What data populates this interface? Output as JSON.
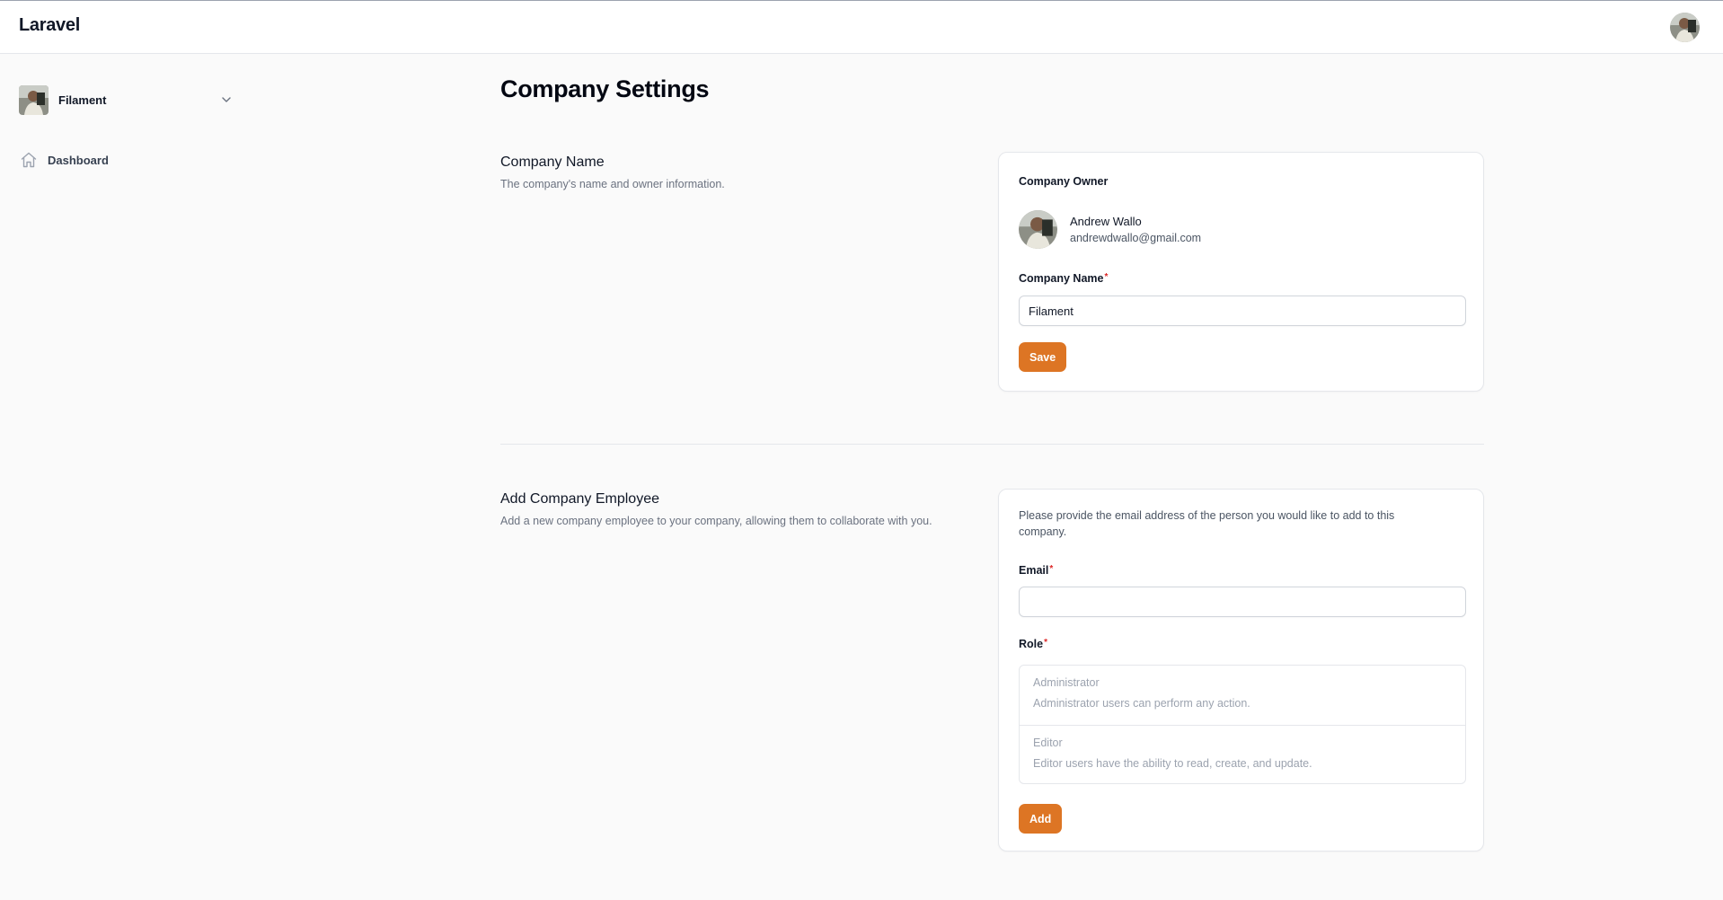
{
  "app": {
    "brand": "Laravel"
  },
  "colors": {
    "primary": "#dd7524",
    "required": "#dc2626"
  },
  "sidebar": {
    "team": {
      "name": "Filament",
      "icon": "chevron-down-icon"
    },
    "items": [
      {
        "label": "Dashboard",
        "icon": "home-icon"
      }
    ]
  },
  "page": {
    "title": "Company Settings"
  },
  "company_name_section": {
    "title": "Company Name",
    "description": "The company's name and owner information.",
    "owner_label": "Company Owner",
    "owner": {
      "name": "Andrew Wallo",
      "email": "andrewdwallo@gmail.com"
    },
    "field_label": "Company Name",
    "required_mark": "*",
    "field_value": "Filament",
    "save_label": "Save"
  },
  "add_employee_section": {
    "title": "Add Company Employee",
    "description": "Add a new company employee to your company, allowing them to collaborate with you.",
    "intro": "Please provide the email address of the person you would like to add to this company.",
    "email_label": "Email",
    "email_value": "",
    "role_label": "Role",
    "required_mark": "*",
    "roles": [
      {
        "name": "Administrator",
        "description": "Administrator users can perform any action."
      },
      {
        "name": "Editor",
        "description": "Editor users have the ability to read, create, and update."
      }
    ],
    "add_label": "Add"
  }
}
